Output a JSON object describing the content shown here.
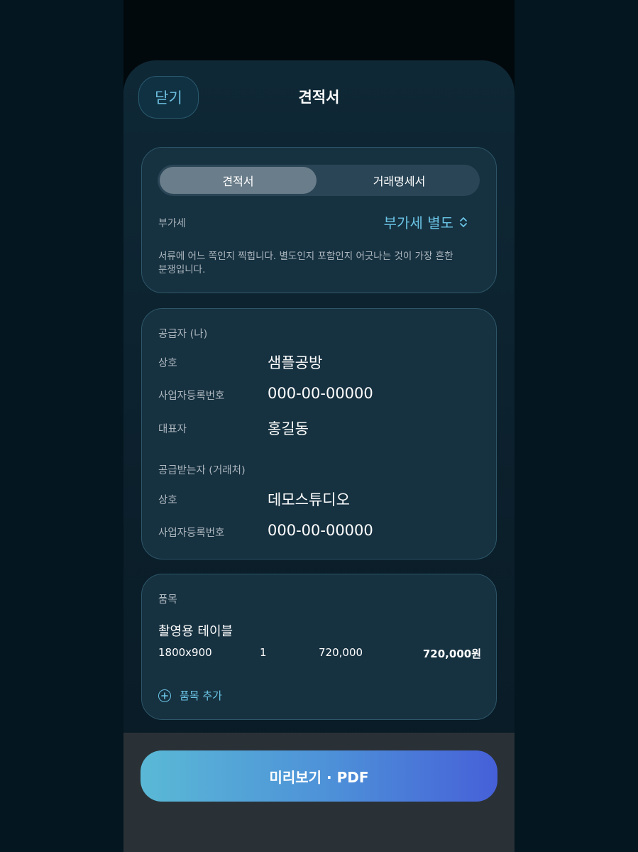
{
  "header": {
    "close_label": "닫기",
    "title": "견적서"
  },
  "doc_type": {
    "options": [
      "견적서",
      "거래명세서"
    ],
    "selected": "견적서"
  },
  "vat": {
    "label": "부가세",
    "value": "부가세 별도",
    "description": "서류에 어느 쪽인지 찍힙니다. 별도인지 포함인지 어긋나는 것이 가장 흔한 분쟁입니다."
  },
  "supplier": {
    "section_title": "공급자 (나)",
    "fields": [
      {
        "label": "상호",
        "value": "샘플공방"
      },
      {
        "label": "사업자등록번호",
        "value": "000-00-00000"
      },
      {
        "label": "대표자",
        "value": "홍길동"
      }
    ]
  },
  "customer": {
    "section_title": "공급받는자 (거래처)",
    "fields": [
      {
        "label": "상호",
        "value": "데모스튜디오"
      },
      {
        "label": "사업자등록번호",
        "value": "000-00-00000"
      }
    ]
  },
  "items": {
    "section_title": "품목",
    "list": [
      {
        "name": "촬영용 테이블",
        "spec": "1800x900",
        "qty": "1",
        "unit_price": "720,000",
        "total": "720,000원"
      }
    ],
    "add_label": "품목 추가"
  },
  "footer": {
    "preview_label": "미리보기 · PDF"
  },
  "colors": {
    "accent": "#6bc5e6",
    "card_bg": "#163140",
    "gradient_start": "#5ab9d6",
    "gradient_end": "#4660d8"
  }
}
